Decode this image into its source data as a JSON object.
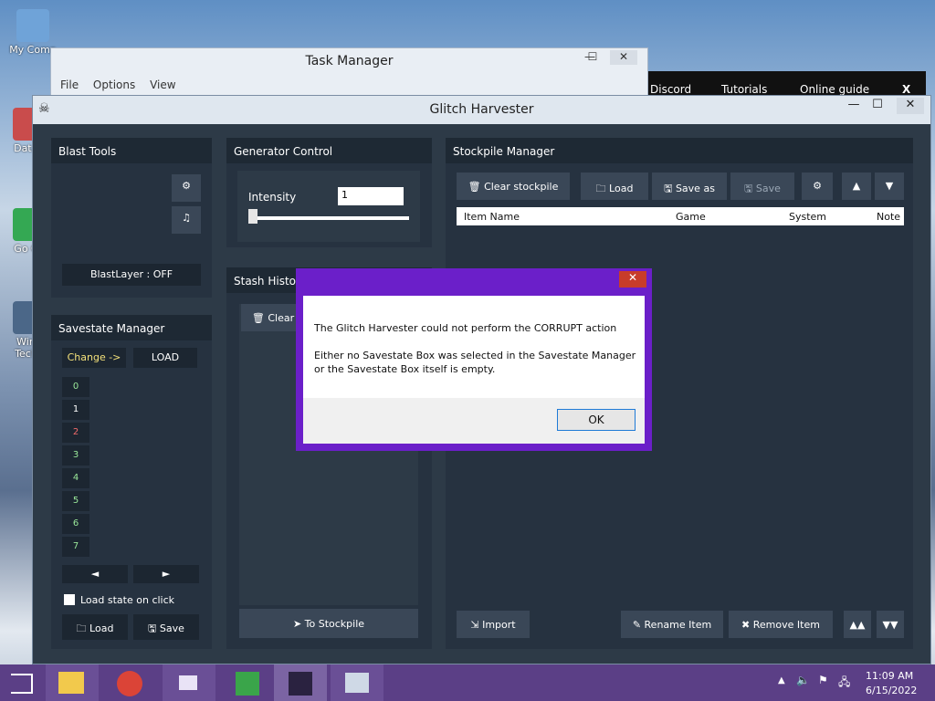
{
  "desktop": {
    "icons": [
      {
        "label": "My Comp"
      },
      {
        "label": "DataV"
      },
      {
        "label": "Go Ch"
      },
      {
        "label": "Wind Techn"
      }
    ]
  },
  "taskmanager": {
    "title": "Task Manager",
    "menu": [
      "File",
      "Options",
      "View"
    ],
    "controls": {
      "minimize": "—",
      "maximize": "☐",
      "close": "✕"
    }
  },
  "discordbar": {
    "items": [
      "Discord",
      "Tutorials",
      "Online guide"
    ],
    "controls": {
      "minimize": "—",
      "close": "X"
    }
  },
  "glitch_harvester": {
    "title": "Glitch Harvester",
    "controls": {
      "minimize": "—",
      "maximize": "☐",
      "close": "✕"
    },
    "blast_tools": {
      "title": "Blast Tools",
      "blastlayer": "BlastLayer : OFF"
    },
    "generator_control": {
      "title": "Generator Control",
      "intensity_label": "Intensity",
      "intensity_value": "1"
    },
    "stash_history": {
      "title": "Stash History",
      "clear_label": "Clear",
      "to_stockpile": "To Stockpile"
    },
    "savestate_manager": {
      "title": "Savestate Manager",
      "change": "Change ->",
      "load_upper": "LOAD",
      "slots": [
        "0",
        "1",
        "2",
        "3",
        "4",
        "5",
        "6",
        "7"
      ],
      "prev": "◄",
      "next": "►",
      "load_on_click": "Load state on click",
      "load": "Load",
      "save": "Save"
    },
    "stockpile_manager": {
      "title": "Stockpile Manager",
      "buttons": {
        "clear": "Clear stockpile",
        "load": "Load",
        "save_as": "Save as",
        "save": "Save",
        "import": "Import",
        "rename": "Rename Item",
        "remove": "Remove Item"
      },
      "columns": [
        "Item Name",
        "Game",
        "System",
        "Note"
      ]
    }
  },
  "dialog": {
    "line1": "The Glitch Harvester could not perform the CORRUPT action",
    "line2": "Either no Savestate Box was selected in the Savestate Manager",
    "line3": "or the Savestate Box itself is empty.",
    "ok": "OK",
    "close": "✕"
  },
  "taskbar": {
    "time": "11:09 AM",
    "date": "6/15/2022"
  },
  "colors": {
    "accent": "#6b1fc9",
    "panel": "#263240",
    "window": "#2d3a47",
    "taskbar": "#5b3f86"
  }
}
